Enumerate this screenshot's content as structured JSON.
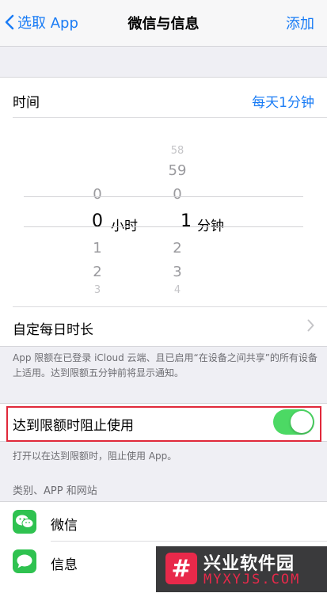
{
  "nav": {
    "back_label": "选取 App",
    "title": "微信与信息",
    "add_label": "添加"
  },
  "time": {
    "label": "时间",
    "value": "每天1分钟"
  },
  "picker": {
    "hours": {
      "above": [
        "0"
      ],
      "selected": "0",
      "unit": "小时",
      "below": [
        "1",
        "2",
        "3"
      ]
    },
    "minutes": {
      "above": [
        "58",
        "59",
        "0"
      ],
      "selected": "1",
      "unit": "分钟",
      "below": [
        "2",
        "3",
        "4"
      ]
    }
  },
  "custom_label": "自定每日时长",
  "note1": "App 限额在已登录 iCloud 云端、且已启用“在设备之间共享”的所有设备上适用。达到限额五分钟前将显示通知。",
  "block": {
    "label": "达到限额时阻止使用",
    "enabled": true,
    "note": "打开以在达到限额时，阻止使用 App。"
  },
  "section_header": "类别、APP 和网站",
  "apps": [
    {
      "name": "微信",
      "icon": "wechat-icon"
    },
    {
      "name": "信息",
      "icon": "messages-icon"
    }
  ],
  "watermark": {
    "logo": "#",
    "title": "兴业软件园",
    "subtitle": "MYXYJS.COM"
  },
  "colors": {
    "accent": "#1a7cf5",
    "toggle_on": "#4cd964",
    "app_icon_green": "#2fc250",
    "highlight": "#e0283a"
  }
}
